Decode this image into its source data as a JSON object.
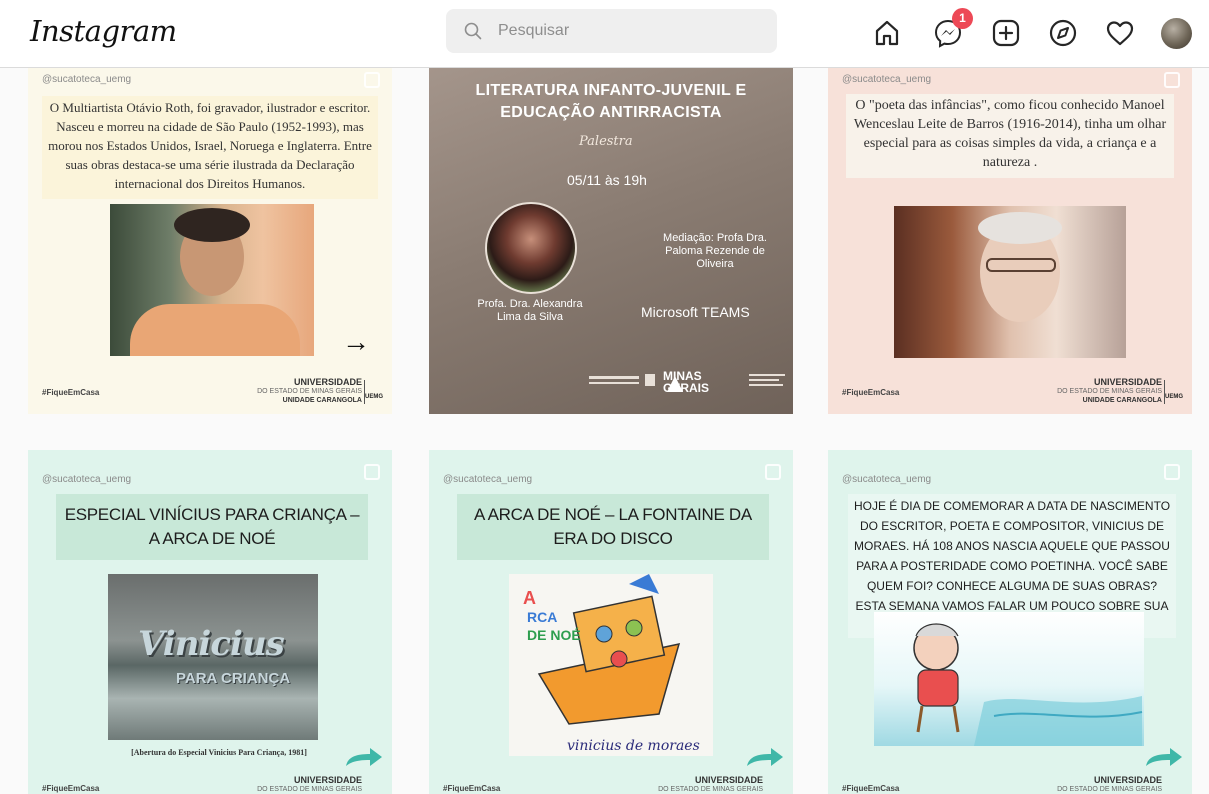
{
  "header": {
    "logo": "Instagram",
    "search_placeholder": "Pesquisar",
    "notification_count": "1"
  },
  "posts": [
    {
      "handle": "@sucatoteca_uemg",
      "text": "O Multiartista Otávio Roth, foi gravador, ilustrador e escritor. Nasceu e morreu na cidade de São Paulo (1952-1993), mas morou nos Estados Unidos, Israel, Noruega e Inglaterra. Entre suas obras destaca-se uma série ilustrada da Declaração internacional dos Direitos Humanos.",
      "hashtag": "#FiqueEmCasa",
      "uni_line1": "UNIVERSIDADE",
      "uni_line2": "DO ESTADO DE MINAS GERAIS",
      "uni_line3": "UNIDADE CARANGOLA",
      "uemg": "UEMG"
    },
    {
      "title": "LITERATURA INFANTO-JUVENIL E EDUCAÇÃO ANTIRRACISTA",
      "script": "Palestra",
      "date": "05/11 às 19h",
      "mediation": "Mediação: Profa Dra. Paloma Rezende de Oliveira",
      "speaker": "Profa. Dra. Alexandra Lima da Silva",
      "platform": "Microsoft TEAMS",
      "mg_logo": "MINAS GERAIS"
    },
    {
      "handle": "@sucatoteca_uemg",
      "text": "O \"poeta das infâncias\", como ficou conhecido Manoel Wenceslau Leite de Barros (1916-2014), tinha um olhar especial para as coisas simples da vida, a criança e a natureza .",
      "hashtag": "#FiqueEmCasa",
      "uni_line1": "UNIVERSIDADE",
      "uni_line2": "DO ESTADO DE MINAS GERAIS",
      "uni_line3": "UNIDADE CARANGOLA",
      "uemg": "UEMG"
    },
    {
      "handle": "@sucatoteca_uemg",
      "title": "ESPECIAL VINÍCIUS PARA CRIANÇA – A ARCA DE NOÉ",
      "image_title": "Vinicius",
      "image_subtitle": "PARA CRIANÇA",
      "caption": "[Abertura do Especial Vinicius Para Criança, 1981]",
      "hashtag": "#FiqueEmCasa",
      "uni_line1": "UNIVERSIDADE",
      "uni_line2": "DO ESTADO DE MINAS GERAIS"
    },
    {
      "handle": "@sucatoteca_uemg",
      "title": "A ARCA DE NOÉ – LA FONTAINE DA ERA DO DISCO",
      "image_caption": "vinicius de moraes",
      "hashtag": "#FiqueEmCasa",
      "uni_line1": "UNIVERSIDADE",
      "uni_line2": "DO ESTADO DE MINAS GERAIS"
    },
    {
      "handle": "@sucatoteca_uemg",
      "text": "HOJE É DIA DE COMEMORAR A DATA DE NASCIMENTO DO ESCRITOR, POETA E COMPOSITOR, VINICIUS DE MORAES. HÁ 108 ANOS NASCIA AQUELE QUE PASSOU PARA A POSTERIDADE COMO POETINHA. VOCÊ SABE QUEM FOI? CONHECE ALGUMA DE SUAS OBRAS? ESTA SEMANA VAMOS FALAR UM POUCO SOBRE SUA VIDA E OBRA.",
      "hashtag": "#FiqueEmCasa",
      "uni_line1": "UNIVERSIDADE",
      "uni_line2": "DO ESTADO DE MINAS GERAIS"
    }
  ],
  "icons": {
    "home": "home-icon",
    "messenger": "messenger-icon",
    "new_post": "new-post-icon",
    "explore": "explore-icon",
    "activity": "heart-icon",
    "profile": "avatar"
  }
}
